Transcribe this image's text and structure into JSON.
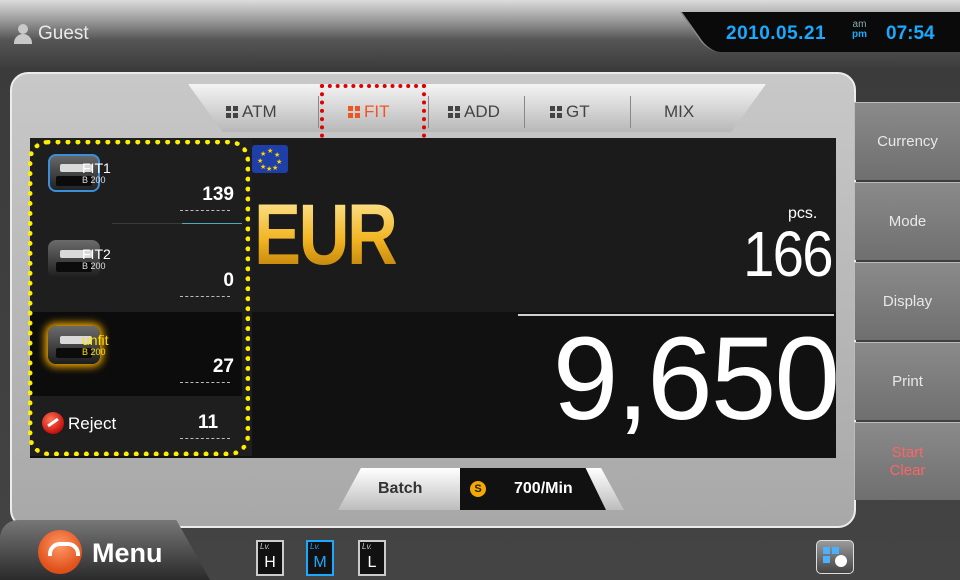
{
  "header": {
    "user": "Guest",
    "date": "2010.05.21",
    "am": "am",
    "pm": "pm",
    "time": "07:54"
  },
  "tabs": [
    {
      "label": "ATM",
      "active": false
    },
    {
      "label": "FIT",
      "active": true
    },
    {
      "label": "ADD",
      "active": false
    },
    {
      "label": "GT",
      "active": false
    },
    {
      "label": "MIX",
      "active": false
    }
  ],
  "pockets": [
    {
      "name": "FIT1",
      "sub": "B 200",
      "count": "139"
    },
    {
      "name": "FIT2",
      "sub": "B 200",
      "count": "0"
    },
    {
      "name": "unfit",
      "sub": "B 200",
      "count": "27"
    }
  ],
  "reject": {
    "label": "Reject",
    "count": "11"
  },
  "display": {
    "currency": "EUR",
    "pcs_unit": "pcs.",
    "pcs": "166",
    "amount": "9,650"
  },
  "batch": {
    "label": "Batch",
    "speed_icon": "S",
    "speed": "700/Min"
  },
  "side_buttons": {
    "currency": "Currency",
    "mode": "Mode",
    "display": "Display",
    "print": "Print",
    "start": "Start",
    "clear": "Clear"
  },
  "menu": {
    "label": "Menu"
  },
  "levels": [
    {
      "tag": "Lv.",
      "level": "H",
      "active": false
    },
    {
      "tag": "Lv.",
      "level": "M",
      "active": true
    },
    {
      "tag": "Lv.",
      "level": "L",
      "active": false
    }
  ],
  "colors": {
    "accent_blue": "#19a9ff",
    "active_tab": "#ee5522",
    "currency_gold": "#f4b52a",
    "start_red": "#ff6464",
    "highlight_yellow": "#ffee00"
  },
  "icons": {
    "user": "user-icon",
    "flag": "eu-flag-icon",
    "reject": "reject-icon",
    "speed": "speed-icon",
    "menu": "menu-icon",
    "status": "status-icon"
  }
}
